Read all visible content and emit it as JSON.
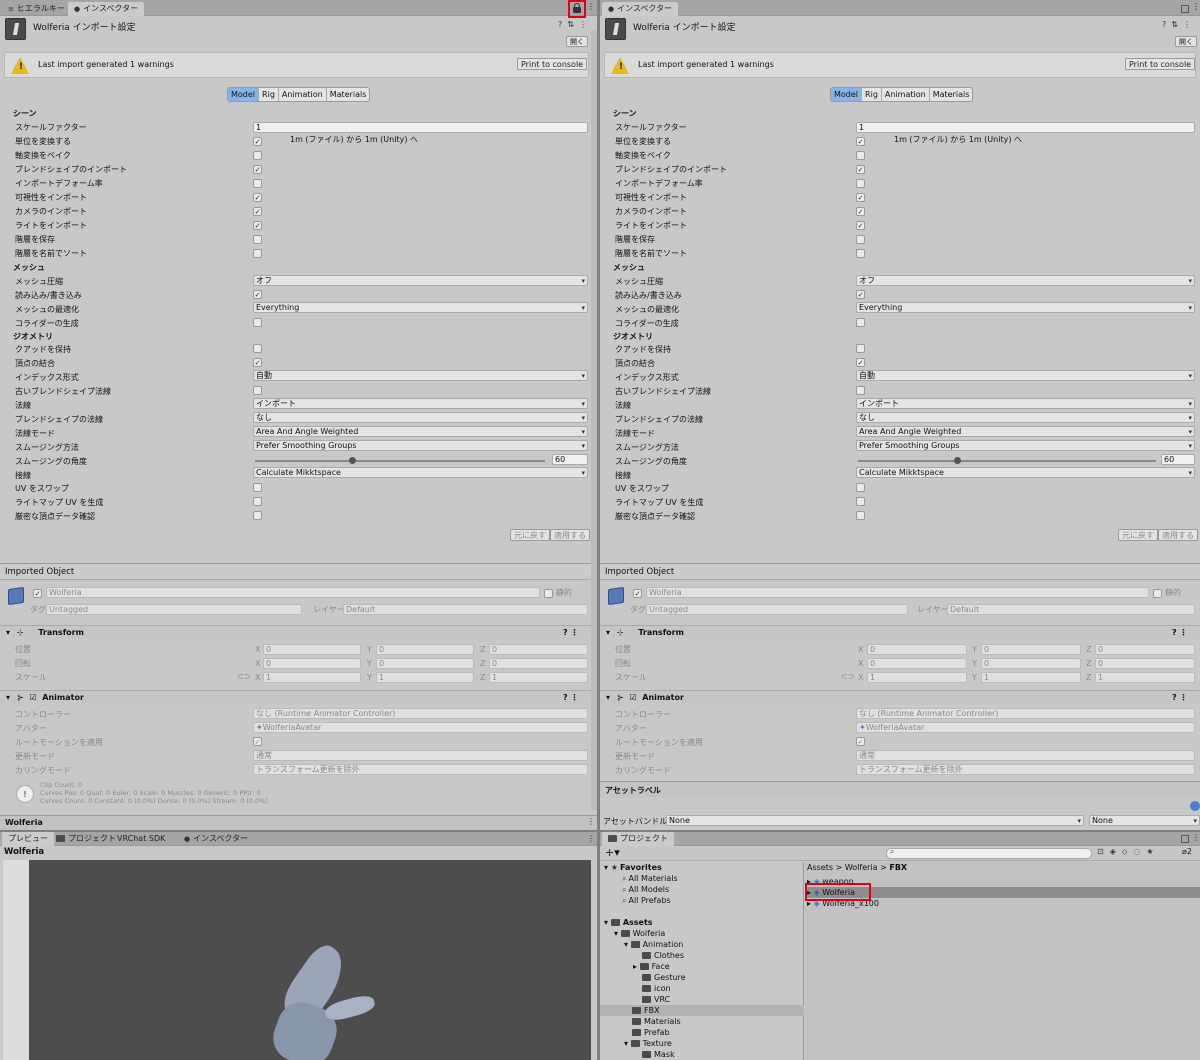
{
  "left": {
    "top_tabs": [
      {
        "label": "ヒエラルキー",
        "icon": "list-icon"
      },
      {
        "label": "インスペクター",
        "icon": "info-icon"
      }
    ],
    "title": "Wolferia インポート設定",
    "open_button": "開く",
    "warning_text": "Last import generated 1 warnings",
    "print_button": "Print to console",
    "model_tabs": [
      "Model",
      "Rig",
      "Animation",
      "Materials"
    ],
    "selected_model_tab": "Model",
    "scene_section": "シーン",
    "scale_factor_label": "スケールファクター",
    "scale_factor_value": "1",
    "convert_units_label": "単位を変換する",
    "convert_units_note": "1m (ファイル) から 1m (Unity) へ",
    "bake_axis_label": "軸変換をベイク",
    "import_blendshapes_label": "ブレンドシェイプのインポート",
    "import_deform_label": "インポートデフォーム率",
    "import_visibility_label": "可視性をインポート",
    "import_cameras_label": "カメラのインポート",
    "import_lights_label": "ライトをインポート",
    "preserve_hierarchy_label": "階層を保存",
    "sort_hierarchy_label": "階層を名前でソート",
    "mesh_section": "メッシュ",
    "mesh_compression_label": "メッシュ圧縮",
    "mesh_compression_value": "オフ",
    "read_write_label": "読み込み/書き込み",
    "optimize_mesh_label": "メッシュの最適化",
    "optimize_mesh_value": "Everything",
    "generate_colliders_label": "コライダーの生成",
    "geometry_section": "ジオメトリ",
    "keep_quads_label": "クアッドを保持",
    "weld_vertices_label": "頂点の結合",
    "index_format_label": "インデックス形式",
    "index_format_value": "自動",
    "legacy_blendshape_label": "古いブレンドシェイプ法線",
    "normals_label": "法線",
    "normals_value": "インポート",
    "blendshape_normals_label": "ブレンドシェイプの法線",
    "blendshape_normals_value": "なし",
    "normals_mode_label": "法線モード",
    "normals_mode_value": "Area And Angle Weighted",
    "smoothing_source_label": "スムージング方法",
    "smoothing_source_value": "Prefer Smoothing Groups",
    "smoothing_angle_label": "スムージングの角度",
    "smoothing_angle_value": "60",
    "smoothing_angle_fraction": 0.333,
    "tangents_label": "接線",
    "tangents_value": "Calculate Mikktspace",
    "swap_uv_label": "UV をスワップ",
    "lightmap_uv_label": "ライトマップ UV を生成",
    "strict_vertex_label": "厳密な頂点データ確認",
    "revert_button": "元に戻す",
    "apply_button": "適用する",
    "imported_object_label": "Imported Object",
    "object_name": "Wolferia",
    "static_label": "静的",
    "tag_label": "タグ",
    "tag_value": "Untagged",
    "layer_label": "レイヤー",
    "layer_value": "Default",
    "transform_label": "Transform",
    "position_label": "位置",
    "rotation_label": "回転",
    "scale_label": "スケール",
    "position": [
      "0",
      "0",
      "0"
    ],
    "rotation": [
      "0",
      "0",
      "0"
    ],
    "scale": [
      "1",
      "1",
      "1"
    ],
    "axis_x": "X",
    "axis_y": "Y",
    "axis_z": "Z",
    "animator_label": "Animator",
    "controller_label": "コントローラー",
    "controller_value": "なし (Runtime Animator Controller)",
    "avatar_label": "アバター",
    "avatar_value": "WolferiaAvatar",
    "root_motion_label": "ルートモーションを適用",
    "update_mode_label": "更新モード",
    "update_mode_value": "通常",
    "culling_mode_label": "カリングモード",
    "culling_mode_value": "トランスフォーム更新を除外",
    "clip_info": [
      "Clip Count: 0",
      "Curves Pos: 0 Quat: 0 Euler: 0 Scale: 0 Muscles: 0 Generic: 0 PPtr: 0",
      "Curves Count: 0 Constant: 0 (0.0%) Dense: 0 (0.0%) Stream: 0 (0.0%)"
    ],
    "footer_name": "Wolferia",
    "bottom_tabs": [
      "プレビュー",
      "プロジェクト",
      "VRChat SDK",
      "インスペクター"
    ],
    "preview_title": "Wolferia"
  },
  "right": {
    "top_tab": "インスペクター",
    "asset_labels": "アセットラベル",
    "asset_bundle_label": "アセットバンドル",
    "asset_bundle_value": "None",
    "asset_variant_value": "None",
    "project_tab": "プロジェクト",
    "favorites": "Favorites",
    "favorite_items": [
      "All Materials",
      "All Models",
      "All Prefabs"
    ],
    "assets": "Assets",
    "tree": [
      "Wolferia",
      "Animation",
      "Clothes",
      "Face",
      "Gesture",
      "icon",
      "VRC",
      "FBX",
      "Materials",
      "Prefab",
      "Texture",
      "Mask"
    ],
    "breadcrumb": [
      "Assets",
      "Wolferia",
      "FBX"
    ],
    "files": [
      "weapon",
      "Wolferia",
      "Wolferia_x100"
    ],
    "selected_file": "Wolferia",
    "search_placeholder": "",
    "hidden_count": "2"
  },
  "colors": {
    "highlight": "#e00018",
    "selected_tab": "#87b4e8",
    "warning": "#e8b81c"
  }
}
